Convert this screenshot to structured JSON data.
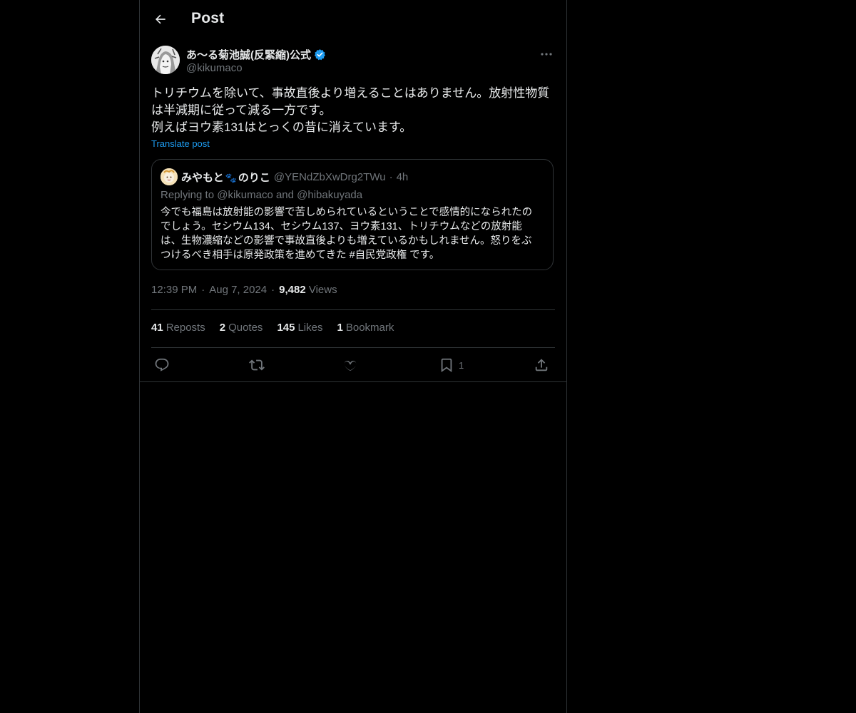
{
  "header": {
    "title": "Post"
  },
  "author": {
    "name": "あ〜る菊池誠(反緊縮)公式",
    "handle": "@kikumaco",
    "verified": true
  },
  "post": {
    "lines": [
      "トリチウムを除いて、事故直後より増えることはありません。放射性物質",
      "は半減期に従って減る一方です。",
      "例えばヨウ素131はとっくの昔に消えています。"
    ],
    "translate_label": "Translate post"
  },
  "quote": {
    "name_part1": "みやもと",
    "name_part2": "のりこ",
    "handle": "@YENdZbXwDrg2TWu",
    "separator": "·",
    "time": "4h",
    "replying": "Replying to @kikumaco and @hibakuyada",
    "lines": [
      "今でも福島は放射能の影響で苦しめられているということで感情的になられたの",
      "でしょう。セシウム134、セシウム137、ヨウ素131、トリチウムなどの放射能",
      "は、生物濃縮などの影響で事故直後よりも増えているかもしれません。怒りをぶ",
      "つけるべき相手は原発政策を進めてきた #自民党政権 です。"
    ]
  },
  "meta": {
    "time": "12:39 PM",
    "date": "Aug 7, 2024",
    "separator": "·",
    "views_count": "9,482",
    "views_label": "Views"
  },
  "stats": {
    "reposts_count": "41",
    "reposts_label": "Reposts",
    "quotes_count": "2",
    "quotes_label": "Quotes",
    "likes_count": "145",
    "likes_label": "Likes",
    "bookmarks_count": "1",
    "bookmarks_label": "Bookmark"
  },
  "actions": {
    "bookmark_count": "1"
  },
  "colors": {
    "background": "#000000",
    "text_primary": "#e7e9ea",
    "text_secondary": "#71767b",
    "accent": "#1d9bf0",
    "border": "#2f3336"
  }
}
